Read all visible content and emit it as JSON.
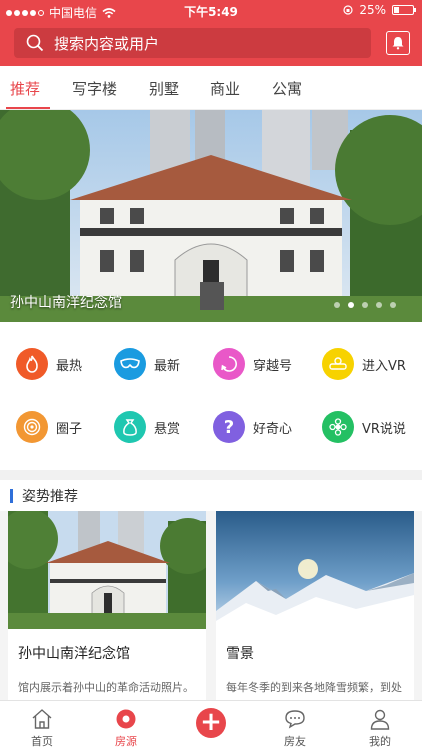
{
  "status_bar": {
    "carrier": "中国电信",
    "time": "下午5:49",
    "battery": "25%",
    "battery_level": 0.25
  },
  "search": {
    "placeholder": "搜索内容或用户"
  },
  "tabs": [
    {
      "label": "推荐",
      "active": true
    },
    {
      "label": "写字楼",
      "active": false
    },
    {
      "label": "别墅",
      "active": false
    },
    {
      "label": "商业",
      "active": false
    },
    {
      "label": "公寓",
      "active": false
    }
  ],
  "banner": {
    "caption": "孙中山南洋纪念馆",
    "slide_count": 5,
    "active_slide": 2
  },
  "quick_links": [
    {
      "label": "最热",
      "icon": "flame-icon",
      "color": "#f05a28"
    },
    {
      "label": "最新",
      "icon": "mask-icon",
      "color": "#1a9be0"
    },
    {
      "label": "穿越号",
      "icon": "swirl-icon",
      "color": "#e958c8"
    },
    {
      "label": "进入VR",
      "icon": "vr-goggles-icon",
      "color": "#f7d200"
    },
    {
      "label": "圈子",
      "icon": "target-icon",
      "color": "#f29733"
    },
    {
      "label": "悬赏",
      "icon": "money-bag-icon",
      "color": "#1fc7b0"
    },
    {
      "label": "好奇心",
      "icon": "question-icon",
      "color": "#8060e0"
    },
    {
      "label": "VR说说",
      "icon": "flower-icon",
      "color": "#24c063"
    }
  ],
  "section": {
    "title": "姿势推荐"
  },
  "cards": [
    {
      "title": "孙中山南洋纪念馆",
      "desc": "馆内展示着孙中山的革命活动照片。"
    },
    {
      "title": "雪景",
      "desc": "每年冬季的到来各地降雪频繁，到处"
    }
  ],
  "bottom_nav": [
    {
      "label": "首页",
      "icon": "home-icon",
      "active": false
    },
    {
      "label": "房源",
      "icon": "record-icon",
      "active": true
    },
    {
      "label": "",
      "icon": "plus-icon",
      "active": false
    },
    {
      "label": "房友",
      "icon": "chat-icon",
      "active": false
    },
    {
      "label": "我的",
      "icon": "user-icon",
      "active": false
    }
  ],
  "colors": {
    "primary": "#e8464b",
    "section_accent": "#2f6fd9"
  }
}
